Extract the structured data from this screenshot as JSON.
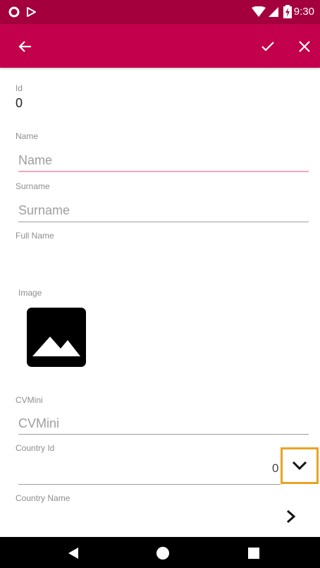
{
  "status_bar": {
    "time": "9:30",
    "icons": [
      "circle-icon",
      "play-store-icon",
      "wifi-icon",
      "signal-icon",
      "battery-charging-icon"
    ]
  },
  "toolbar": {
    "back_icon": "arrow-left-icon",
    "confirm_icon": "check-icon",
    "close_icon": "close-icon"
  },
  "form": {
    "id": {
      "label": "Id",
      "value": "0"
    },
    "name": {
      "label": "Name",
      "placeholder": "Name"
    },
    "surname": {
      "label": "Surname",
      "placeholder": "Surname"
    },
    "full_name": {
      "label": "Full Name"
    },
    "image": {
      "label": "Image",
      "icon": "image-placeholder-icon"
    },
    "cvmini": {
      "label": "CVMini",
      "placeholder": "CVMini"
    },
    "country_id": {
      "label": "Country Id",
      "value": "0",
      "icon": "chevron-down-icon"
    },
    "country_name": {
      "label": "Country Name",
      "icon": "chevron-right-icon"
    }
  },
  "colors": {
    "status_bar": "#a4003e",
    "toolbar": "#c2004b",
    "focus_underline": "#f4a6bf",
    "highlight": "#e8a323"
  },
  "nav_bar": {
    "icons": [
      "back-triangle-icon",
      "home-circle-icon",
      "recents-square-icon"
    ]
  }
}
